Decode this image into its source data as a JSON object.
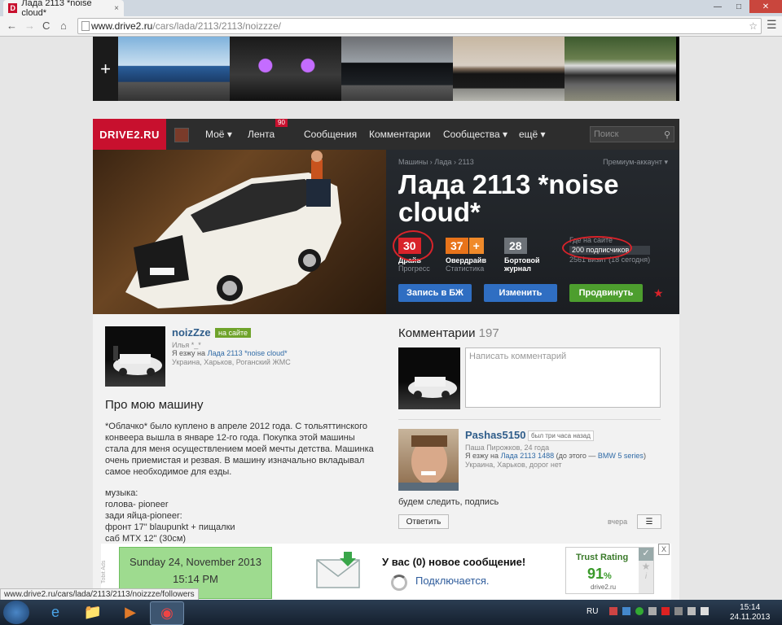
{
  "browser": {
    "tab_title": "Лада 2113 *noise cloud*",
    "tab_favicon": "D",
    "tab_close": "×",
    "url_host": "www.drive2.ru",
    "url_path": "/cars/lada/2113/2113/noizzze/",
    "nav_back": "←",
    "nav_forward": "→",
    "nav_reload": "C",
    "nav_home": "⌂",
    "status_url": "www.drive2.ru/cars/lada/2113/2113/noizzze/followers"
  },
  "site": {
    "logo": "DRIVE2.RU",
    "nav": [
      "Моё ▾",
      "Лента",
      "Сообщения",
      "Комментарии",
      "Сообщества ▾",
      "ещё ▾"
    ],
    "feed_badge": "90",
    "search_placeholder": "Поиск",
    "strip_plus": "+"
  },
  "car": {
    "breadcrumb": "Машины › Лада › 2113",
    "premium": "Премиум-аккаунт ▾",
    "title": "Лада 2113 *noise cloud*",
    "stats": {
      "drive_value": "30",
      "drive_label": "Драйв",
      "drive_sub": "Прогресс",
      "overdrive_value": "37",
      "overdrive_plus": "+",
      "overdrive_label": "Овердрайв",
      "overdrive_sub": "Статистика",
      "log_value": "28",
      "log_label": "Бортовой",
      "log_label2": "журнал",
      "online": "Где на сайте",
      "followers": "200 подписчиков",
      "visits": "2561 визит (18 сегодня)"
    },
    "buttons": {
      "log_entry": "Запись в БЖ",
      "edit": "Изменить",
      "promote": "Продвинуть"
    }
  },
  "owner": {
    "name": "noizZze",
    "status": "на сайте",
    "real_name": "Илья *_*",
    "drives_prefix": "Я езжу на",
    "drives_car": "Лада 2113 *noise cloud*",
    "location": "Украина, Харьков, Роганский ЖМС"
  },
  "about": {
    "heading": "Про мою машину",
    "text": "*Облачко* было куплено в апреле 2012 года. С тольяттинского конвеера вышла в январе 12-го года. Покупка этой машины стала для меня осуществлением моей мечты детства. Машинка очень приемистая и резвая. В машину изначально вкладывал самое необходимое для езды.",
    "music": [
      "музыка:",
      "голова- pioneer",
      "зади яйца-pioneer:",
      "фронт 17\" blaupunkt + пищалки",
      "саб MTX 12\" (30см)"
    ]
  },
  "comments": {
    "heading": "Комментарии",
    "count": "197",
    "placeholder": "Написать комментарий",
    "item": {
      "author": "Pashas5150",
      "ago": "был три часа назад",
      "meta": "Паша Пирожков, 24 года",
      "drives_prefix": "Я езжу на",
      "drives_car": "Лада 2113 1488",
      "drives_mid": "(до этого —",
      "drives_prev": "BMW 5 series",
      "drives_end": ")",
      "location": "Украина, Харьков, дорог нет",
      "text": "будем следить, подпись",
      "reply": "Ответить",
      "when": "вчера",
      "menu": "☰"
    }
  },
  "ad": {
    "label": "Tobit Ads",
    "date": "Sunday 24, November 2013",
    "time": "15:14 PM",
    "message": "У вас (0) новое сообщение!",
    "connecting": "Подключается.",
    "trust_title": "Trust Rating",
    "trust_value": "91",
    "trust_unit": "%",
    "trust_site": "drive2.ru",
    "close": "X"
  },
  "taskbar": {
    "lang": "RU",
    "time": "15:14",
    "date": "24.11.2013"
  }
}
